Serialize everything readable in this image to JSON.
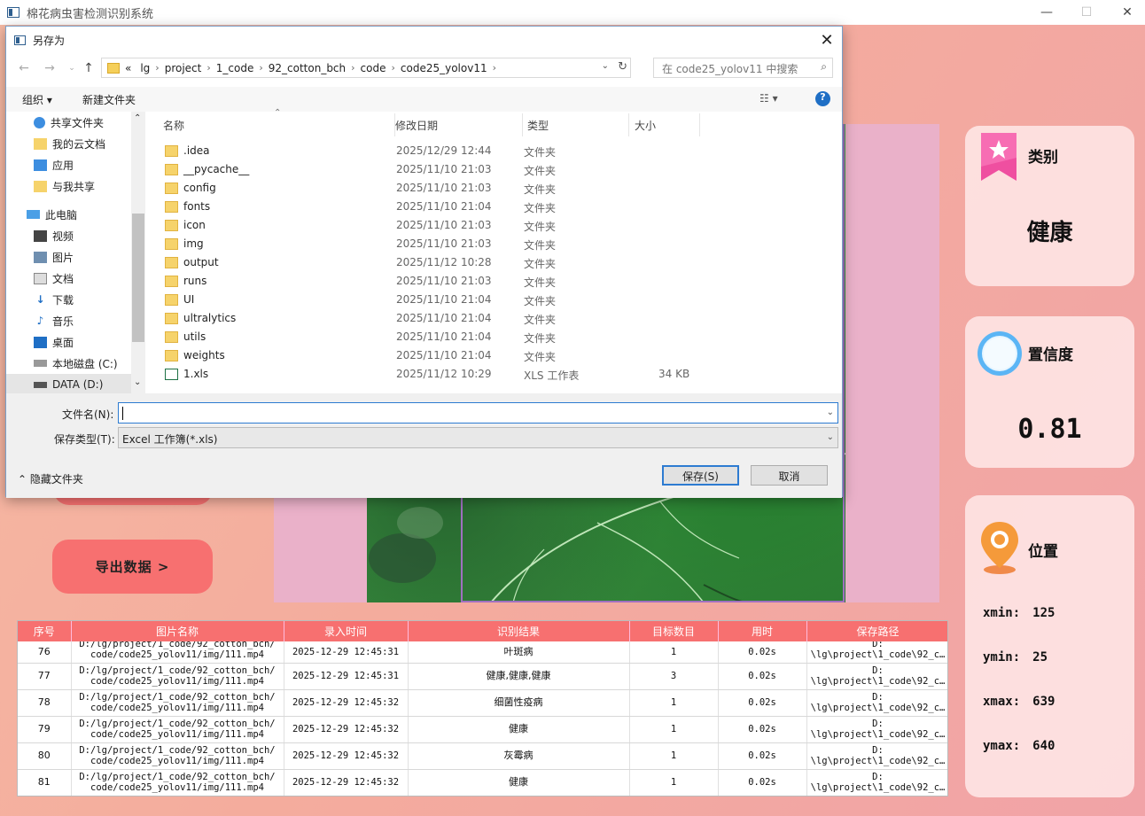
{
  "window": {
    "title": "棉花病虫害检测识别系统",
    "minimize": "—",
    "maximize": "☐",
    "close": "✕"
  },
  "left_panel": {
    "export_label": "导出数据 >"
  },
  "cards": {
    "category": {
      "title": "类别",
      "value": "健康"
    },
    "confidence": {
      "title": "置信度",
      "value": "0.81"
    },
    "location": {
      "title": "位置",
      "rows": [
        {
          "label": "xmin:",
          "value": "125"
        },
        {
          "label": "ymin:",
          "value": "25"
        },
        {
          "label": "xmax:",
          "value": "639"
        },
        {
          "label": "ymax:",
          "value": "640"
        }
      ]
    }
  },
  "table": {
    "headers": [
      "序号",
      "图片名称",
      "录入时间",
      "识别结果",
      "目标数目",
      "用时",
      "保存路径"
    ],
    "rows": [
      {
        "id": "76",
        "name1": "D:/lg/project/1_code/92_cotton_bch/",
        "name2": "code/code25_yolov11/img/111.mp4",
        "time": "2025-12-29 12:45:31",
        "result": "叶斑病",
        "count": "1",
        "dur": "0.02s",
        "path1": "D:",
        "path2": "\\lg\\project\\1_code\\92_c…"
      },
      {
        "id": "77",
        "name1": "D:/lg/project/1_code/92_cotton_bch/",
        "name2": "code/code25_yolov11/img/111.mp4",
        "time": "2025-12-29 12:45:31",
        "result": "健康,健康,健康",
        "count": "3",
        "dur": "0.02s",
        "path1": "D:",
        "path2": "\\lg\\project\\1_code\\92_c…"
      },
      {
        "id": "78",
        "name1": "D:/lg/project/1_code/92_cotton_bch/",
        "name2": "code/code25_yolov11/img/111.mp4",
        "time": "2025-12-29 12:45:32",
        "result": "细菌性疫病",
        "count": "1",
        "dur": "0.02s",
        "path1": "D:",
        "path2": "\\lg\\project\\1_code\\92_c…"
      },
      {
        "id": "79",
        "name1": "D:/lg/project/1_code/92_cotton_bch/",
        "name2": "code/code25_yolov11/img/111.mp4",
        "time": "2025-12-29 12:45:32",
        "result": "健康",
        "count": "1",
        "dur": "0.02s",
        "path1": "D:",
        "path2": "\\lg\\project\\1_code\\92_c…"
      },
      {
        "id": "80",
        "name1": "D:/lg/project/1_code/92_cotton_bch/",
        "name2": "code/code25_yolov11/img/111.mp4",
        "time": "2025-12-29 12:45:32",
        "result": "灰霉病",
        "count": "1",
        "dur": "0.02s",
        "path1": "D:",
        "path2": "\\lg\\project\\1_code\\92_c…"
      },
      {
        "id": "81",
        "name1": "D:/lg/project/1_code/92_cotton_bch/",
        "name2": "code/code25_yolov11/img/111.mp4",
        "time": "2025-12-29 12:45:32",
        "result": "健康",
        "count": "1",
        "dur": "0.02s",
        "path1": "D:",
        "path2": "\\lg\\project\\1_code\\92_c…"
      }
    ]
  },
  "dialog": {
    "title": "另存为",
    "breadcrumbs": [
      "lg",
      "project",
      "1_code",
      "92_cotton_bch",
      "code",
      "code25_yolov11"
    ],
    "overflow": "«",
    "search_placeholder": "在 code25_yolov11 中搜索",
    "organize": "组织 ▾",
    "new_folder": "新建文件夹",
    "tree": [
      {
        "label": "共享文件夹",
        "icon": "share-icon"
      },
      {
        "label": "我的云文档",
        "icon": "folder-icon"
      },
      {
        "label": "应用",
        "icon": "apps-icon"
      },
      {
        "label": "与我共享",
        "icon": "folder-icon"
      },
      {
        "label": "此电脑",
        "icon": "computer-icon"
      },
      {
        "label": "视频",
        "icon": "video-icon"
      },
      {
        "label": "图片",
        "icon": "picture-icon"
      },
      {
        "label": "文档",
        "icon": "document-icon"
      },
      {
        "label": "下载",
        "icon": "download-icon"
      },
      {
        "label": "音乐",
        "icon": "music-icon"
      },
      {
        "label": "桌面",
        "icon": "desktop-icon"
      },
      {
        "label": "本地磁盘 (C:)",
        "icon": "drive-icon"
      },
      {
        "label": "DATA (D:)",
        "icon": "drive-icon"
      }
    ],
    "columns": [
      "名称",
      "修改日期",
      "类型",
      "大小"
    ],
    "files": [
      {
        "name": ".idea",
        "date": "2025/12/29 12:44",
        "type": "文件夹",
        "size": ""
      },
      {
        "name": "__pycache__",
        "date": "2025/11/10 21:03",
        "type": "文件夹",
        "size": ""
      },
      {
        "name": "config",
        "date": "2025/11/10 21:03",
        "type": "文件夹",
        "size": ""
      },
      {
        "name": "fonts",
        "date": "2025/11/10 21:04",
        "type": "文件夹",
        "size": ""
      },
      {
        "name": "icon",
        "date": "2025/11/10 21:03",
        "type": "文件夹",
        "size": ""
      },
      {
        "name": "img",
        "date": "2025/11/10 21:03",
        "type": "文件夹",
        "size": ""
      },
      {
        "name": "output",
        "date": "2025/11/12 10:28",
        "type": "文件夹",
        "size": ""
      },
      {
        "name": "runs",
        "date": "2025/11/10 21:03",
        "type": "文件夹",
        "size": ""
      },
      {
        "name": "UI",
        "date": "2025/11/10 21:04",
        "type": "文件夹",
        "size": ""
      },
      {
        "name": "ultralytics",
        "date": "2025/11/10 21:04",
        "type": "文件夹",
        "size": ""
      },
      {
        "name": "utils",
        "date": "2025/11/10 21:04",
        "type": "文件夹",
        "size": ""
      },
      {
        "name": "weights",
        "date": "2025/11/10 21:04",
        "type": "文件夹",
        "size": ""
      },
      {
        "name": "1.xls",
        "date": "2025/11/12 10:29",
        "type": "XLS 工作表",
        "size": "34 KB"
      }
    ],
    "filename_label": "文件名(N):",
    "filename_value": "",
    "filetype_label": "保存类型(T):",
    "filetype_value": "Excel 工作簿(*.xls)",
    "hide_folders": "隐藏文件夹",
    "save": "保存(S)",
    "cancel": "取消"
  }
}
